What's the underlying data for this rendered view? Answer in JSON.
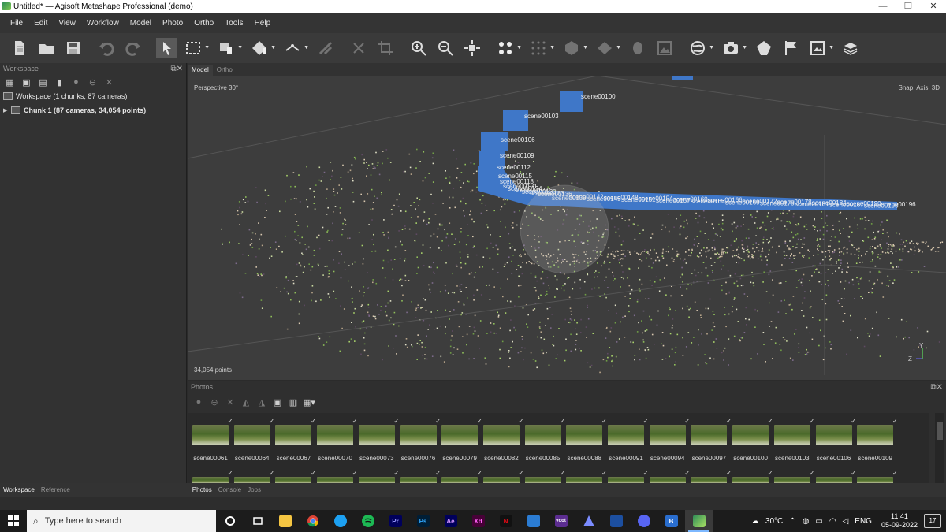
{
  "window": {
    "title": "Untitled* — Agisoft Metashape Professional (demo)",
    "controls": [
      "—",
      "❐",
      "✕"
    ]
  },
  "menu": [
    "File",
    "Edit",
    "View",
    "Workflow",
    "Model",
    "Photo",
    "Ortho",
    "Tools",
    "Help"
  ],
  "workspace": {
    "title": "Workspace",
    "root": "Workspace (1 chunks, 87 cameras)",
    "chunk": "Chunk 1 (87 cameras, 34,054 points)"
  },
  "viewport_tabs": [
    "Model",
    "Ortho"
  ],
  "viewport": {
    "perspective": "Perspective 30°",
    "snap": "Snap: Axis, 3D",
    "points": "34,054 points",
    "axis_z": "Z",
    "axis_y": "Y",
    "camera_labels": [
      "scene00100",
      "scene00103",
      "scene00106",
      "scene00109",
      "scene00112",
      "scene00115",
      "scene00118",
      "scene00121",
      "scene00124",
      "scene00127",
      "scene00130",
      "scene00133",
      "scene00136",
      "scene00139",
      "scene00142",
      "scene00145",
      "scene00148",
      "scene00151",
      "scene00154",
      "scene00157",
      "scene00160",
      "scene00163",
      "scene00166",
      "scene00169",
      "scene00172",
      "scene00175",
      "scene00178",
      "scene00181",
      "scene00184",
      "scene00187",
      "scene00190",
      "scene00193",
      "scene00196"
    ]
  },
  "photos": {
    "title": "Photos",
    "labels": [
      "scene00061",
      "scene00064",
      "scene00067",
      "scene00070",
      "scene00073",
      "scene00076",
      "scene00079",
      "scene00082",
      "scene00085",
      "scene00088",
      "scene00091",
      "scene00094",
      "scene00097",
      "scene00100",
      "scene00103",
      "scene00106",
      "scene00109"
    ]
  },
  "bottom_tabs_left": [
    "Workspace",
    "Reference"
  ],
  "bottom_tabs_right": [
    "Photos",
    "Console",
    "Jobs"
  ],
  "taskbar": {
    "search_placeholder": "Type here to search",
    "temperature": "30°C",
    "language": "ENG",
    "time": "11:41",
    "date": "05-09-2022",
    "notifications": "17",
    "apps": [
      {
        "name": "Ps",
        "color": "#31a8ff",
        "bg": "#001e36"
      },
      {
        "name": "Ae",
        "color": "#d291ff",
        "bg": "#00005b"
      },
      {
        "name": "Xd",
        "color": "#ff61f6",
        "bg": "#470137"
      },
      {
        "name": "Pr",
        "color": "#9999ff",
        "bg": "#00005b"
      }
    ]
  }
}
